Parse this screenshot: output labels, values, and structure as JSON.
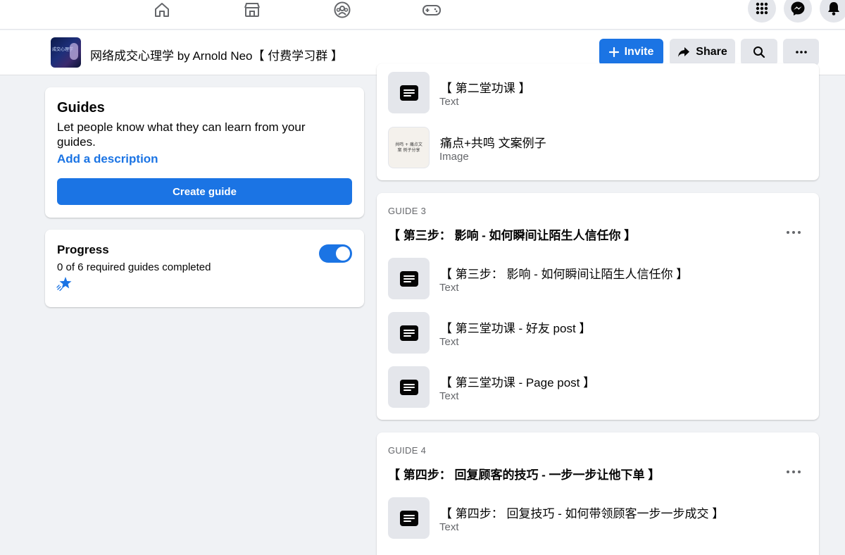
{
  "topnav": {
    "tabs": [
      "home-icon",
      "marketplace-icon",
      "groups-icon",
      "gaming-icon"
    ],
    "actions": [
      "menu-grid-icon",
      "messenger-icon",
      "notifications-icon"
    ]
  },
  "group": {
    "title": "网络成交心理学 by Arnold Neo【 付费学习群 】",
    "thumb_text": "成交心理学",
    "buttons": {
      "invite": "Invite",
      "share": "Share"
    }
  },
  "guides_card": {
    "heading": "Guides",
    "description": "Let people know what they can learn from your guides.",
    "add_link": "Add a description",
    "create_button": "Create guide"
  },
  "progress_card": {
    "heading": "Progress",
    "status": "0 of 6 required guides completed",
    "toggle_on": true
  },
  "guide2_tail": {
    "items": [
      {
        "title": "【 第二堂功课 】",
        "type": "Text"
      },
      {
        "title": "痛点+共鸣 文案例子",
        "type": "Image",
        "thumb_text": "共鸣 + 痛点文案 例子分享"
      }
    ]
  },
  "guide3": {
    "label": "GUIDE 3",
    "title": "【 第三步： 影响 - 如何瞬间让陌生人信任你 】",
    "items": [
      {
        "title": "【 第三步： 影响 - 如何瞬间让陌生人信任你 】",
        "type": "Text"
      },
      {
        "title": "【 第三堂功课 - 好友 post 】",
        "type": "Text"
      },
      {
        "title": "【 第三堂功课 - Page post 】",
        "type": "Text"
      }
    ]
  },
  "guide4": {
    "label": "GUIDE 4",
    "title": "【 第四步： 回复顾客的技巧 - 一步一步让他下单 】",
    "items": [
      {
        "title": "【 第四步： 回复技巧 - 如何带领顾客一步一步成交 】",
        "type": "Text"
      }
    ]
  },
  "colors": {
    "accent": "#1b74e4",
    "background": "#f0f2f5",
    "secondary_text": "#65676b",
    "button_gray": "#e4e6eb"
  }
}
